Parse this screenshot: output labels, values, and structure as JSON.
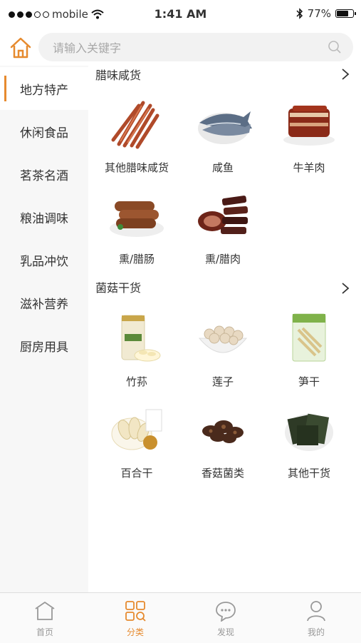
{
  "status_bar": {
    "carrier": "mobile",
    "time": "1:41 AM",
    "battery": "77%",
    "battery_level": 0.77
  },
  "search": {
    "placeholder": "请输入关键字"
  },
  "sidebar": {
    "items": [
      {
        "label": "地方特产",
        "active": true
      },
      {
        "label": "休闲食品"
      },
      {
        "label": "茗茶名酒"
      },
      {
        "label": "粮油调味"
      },
      {
        "label": "乳品冲饮"
      },
      {
        "label": "滋补营养"
      },
      {
        "label": "厨房用具"
      }
    ]
  },
  "sections": [
    {
      "title": "腊味咸货",
      "items": [
        {
          "label": "其他腊味咸货",
          "icon": "jerky-strips-image"
        },
        {
          "label": "咸鱼",
          "icon": "salted-fish-image"
        },
        {
          "label": "牛羊肉",
          "icon": "braised-meat-image"
        },
        {
          "label": "熏/腊肠",
          "icon": "sausage-image"
        },
        {
          "label": "熏/腊肉",
          "icon": "cured-meat-image"
        }
      ]
    },
    {
      "title": "菌菇干货",
      "items": [
        {
          "label": "竹荪",
          "icon": "bamboo-fungus-jar-image"
        },
        {
          "label": "莲子",
          "icon": "lotus-seed-bowl-image"
        },
        {
          "label": "笋干",
          "icon": "dried-bamboo-shoot-bag-image"
        },
        {
          "label": "百合干",
          "icon": "dried-lily-image"
        },
        {
          "label": "香菇菌类",
          "icon": "mushroom-image"
        },
        {
          "label": "其他干货",
          "icon": "seaweed-image"
        }
      ]
    }
  ],
  "tabbar": {
    "items": [
      {
        "label": "首页",
        "icon": "home-icon"
      },
      {
        "label": "分类",
        "icon": "category-icon",
        "active": true
      },
      {
        "label": "发现",
        "icon": "chat-bubble-icon"
      },
      {
        "label": "我的",
        "icon": "user-icon"
      }
    ]
  },
  "colors": {
    "accent": "#e68a2e",
    "sidebar_bg": "#f7f7f7",
    "search_bg": "#f2f2f2"
  }
}
